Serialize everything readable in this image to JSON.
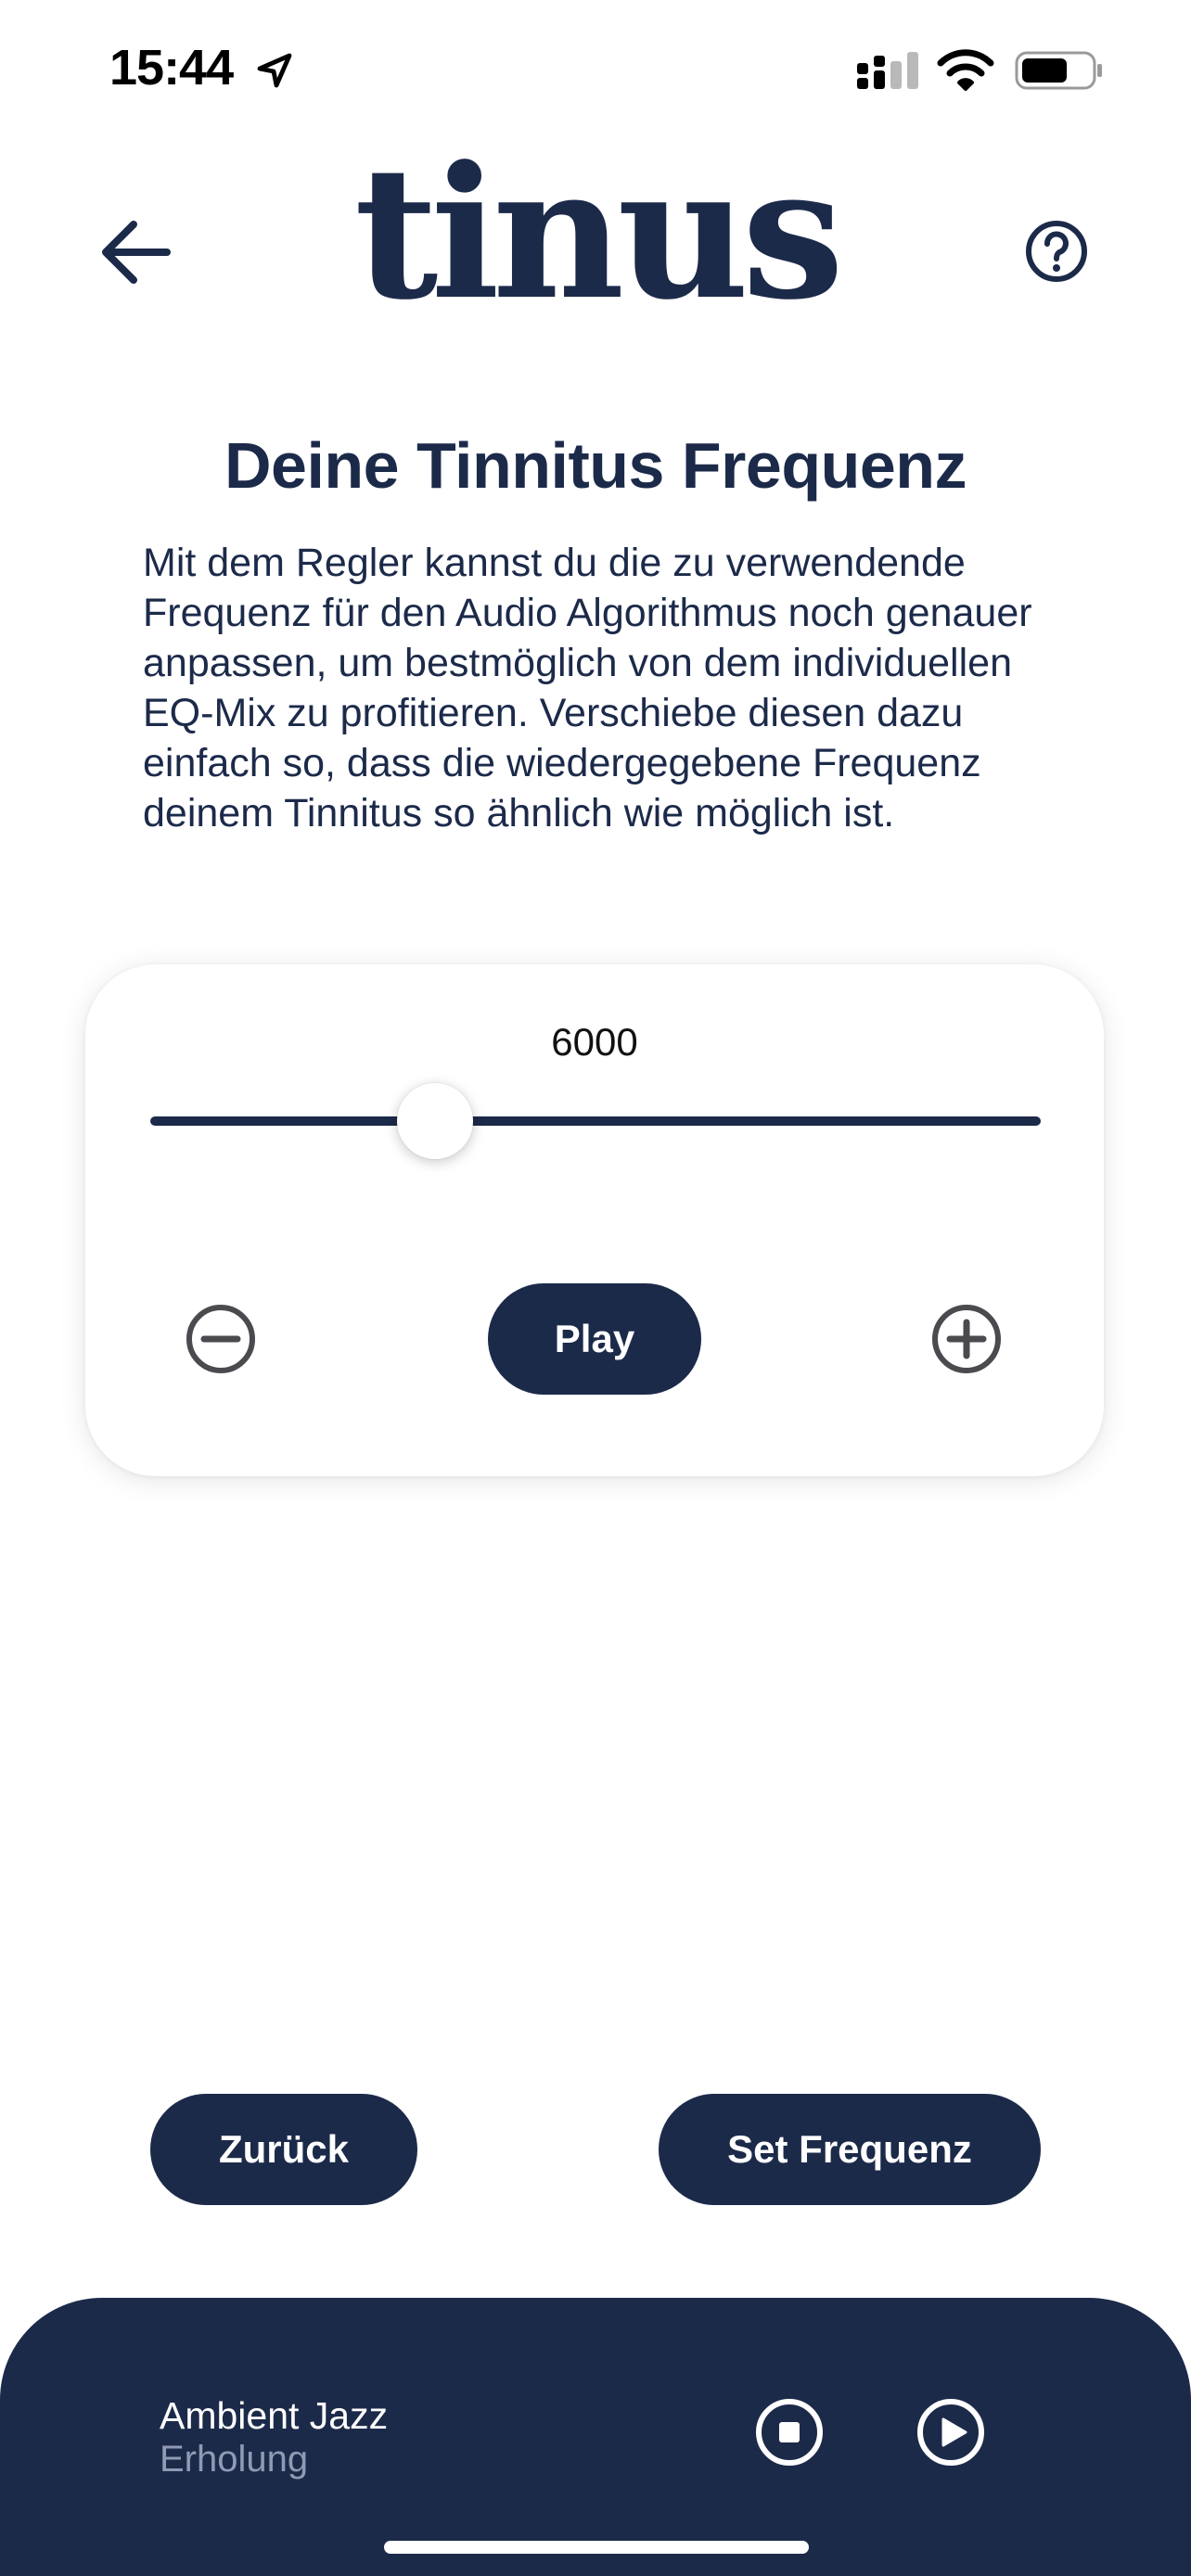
{
  "status_bar": {
    "time": "15:44"
  },
  "header": {
    "logo_text": "tinus",
    "back_icon": "arrow-left-icon",
    "help_icon": "question-circle-icon"
  },
  "main": {
    "title": "Deine Tinnitus Frequenz",
    "description": "Mit dem Regler kannst du die zu verwendende Frequenz für den Audio Algorithmus noch genauer anpassen, um bestmöglich von dem individuellen EQ-Mix zu profitieren. Verschiebe diesen dazu einfach so, dass die wiedergegebene Frequenz deinem Tinnitus so ähnlich wie möglich ist."
  },
  "frequency_card": {
    "value": "6000",
    "slider_fraction": 0.32,
    "play_label": "Play",
    "minus_icon": "minus-circle-icon",
    "plus_icon": "plus-circle-icon"
  },
  "actions": {
    "back_label": "Zurück",
    "set_label": "Set Frequenz"
  },
  "player": {
    "title": "Ambient Jazz",
    "subtitle": "Erholung",
    "stop_icon": "stop-circle-icon",
    "play_icon": "play-circle-icon"
  },
  "colors": {
    "primary": "#1c2a4a",
    "background": "#ffffff",
    "player_subtitle": "#8f9bb3"
  }
}
